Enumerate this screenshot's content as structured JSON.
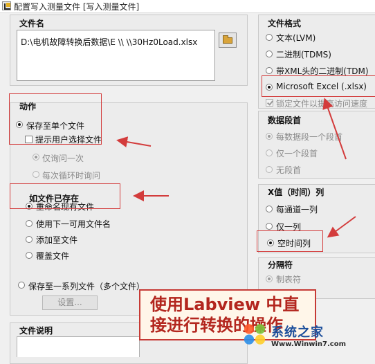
{
  "window": {
    "title": "配置写入测量文件 [写入测量文件]"
  },
  "file_name": {
    "label": "文件名",
    "path": "D:\\电机故障转换后数据\\E  \\\\   \\\\30Hz0Load.xlsx",
    "browse_icon": "folder-icon"
  },
  "action": {
    "label": "动作",
    "save_single": "保存至单个文件",
    "prompt_user": "提示用户选择文件",
    "ask_once": "仅询问一次",
    "ask_each_loop": "每次循环时询问",
    "save_series": "保存至一系列文件（多个文件）",
    "settings_button": "设置..."
  },
  "if_exists": {
    "label": "如文件已存在",
    "options": [
      "重命名现有文件",
      "使用下一可用文件名",
      "添加至文件",
      "覆盖文件"
    ]
  },
  "file_description": {
    "label": "文件说明"
  },
  "file_format": {
    "label": "文件格式",
    "options": [
      "文本(LVM)",
      "二进制(TDMS)",
      "带XML头的二进制(TDM)",
      "Microsoft Excel (.xlsx)"
    ],
    "lock_file": "锁定文件以提高访问速度"
  },
  "data_segment": {
    "label": "数据段首",
    "options": [
      "每数据段一个段首",
      "仅一个段首",
      "无段首"
    ]
  },
  "x_value": {
    "label": "X值（时间）列",
    "options": [
      "每通道一列",
      "仅一列",
      "空时间列"
    ]
  },
  "separator": {
    "label": "分隔符",
    "tab": "制表符"
  },
  "callout": {
    "line1": "使用Labview 中直",
    "line2": "接进行转换的操作"
  },
  "watermark": {
    "brand": "系统之家",
    "url": "Www.Winwin7.com"
  },
  "colors": {
    "annotation_red": "#d33c3c",
    "callout_text": "#b3261e"
  }
}
